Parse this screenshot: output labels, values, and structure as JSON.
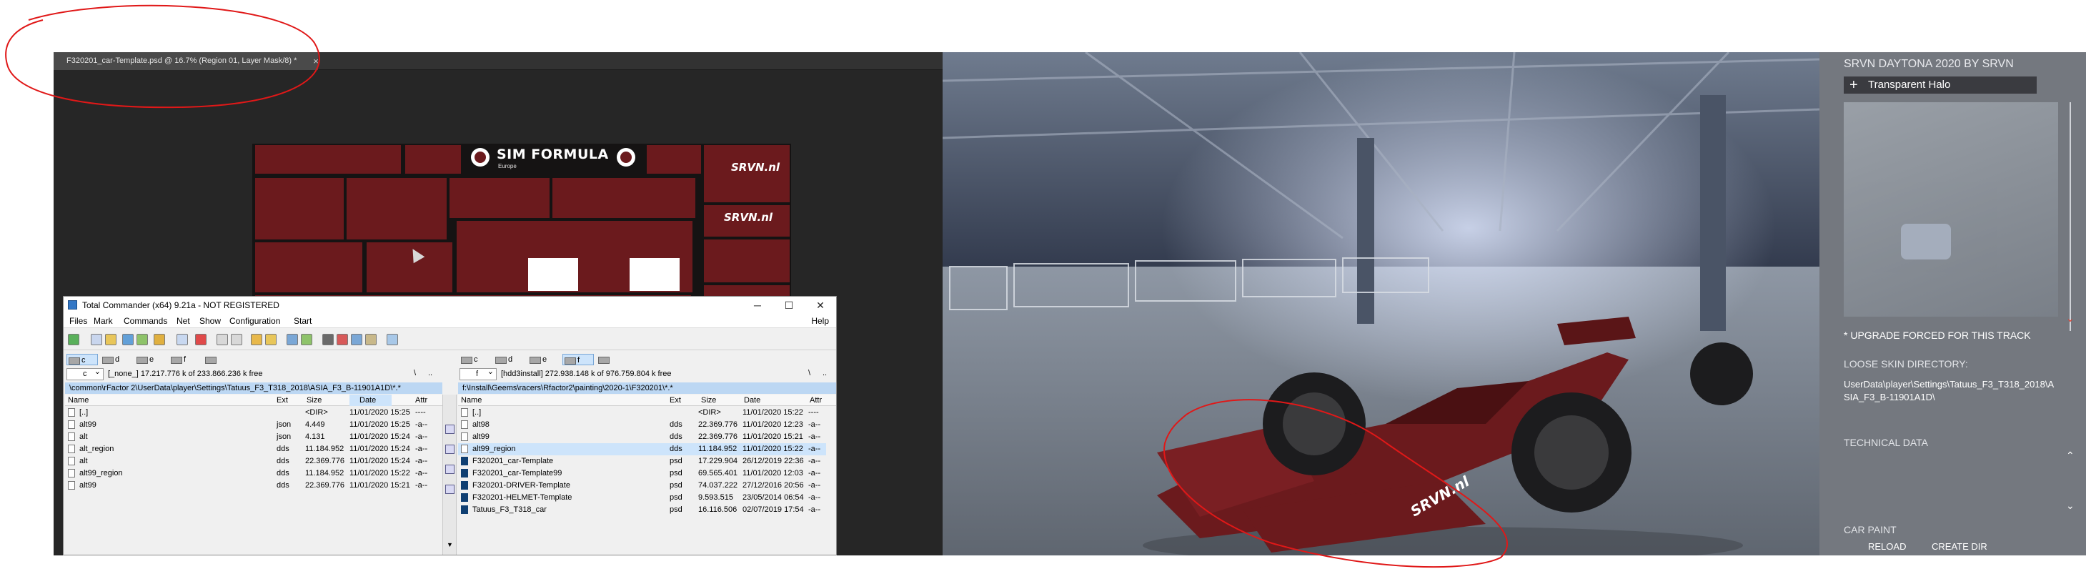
{
  "colors": {
    "livery_red": "#6b1a1d",
    "annotation_red": "#e01818",
    "tc_path_bar": "#bcd7f3",
    "tc_selection": "#cde4fb"
  },
  "photoshop": {
    "tab_title": "F320201_car-Template.psd @ 16.7% (Region 01, Layer Mask/8) *",
    "tab_close": "×",
    "template": {
      "logo_title": "SIM FORMULA",
      "logo_sub": "Europe",
      "srvn_1": "SRVN.nl",
      "srvn_2": "SRVN.nl"
    }
  },
  "total_commander": {
    "title": "Total Commander (x64) 9.21a - NOT REGISTERED",
    "window_buttons": {
      "minimize": "─",
      "maximize": "☐",
      "close": "✕"
    },
    "menu": [
      "Files",
      "Mark",
      "Commands",
      "Net",
      "Show",
      "Configuration",
      "Start"
    ],
    "help": "Help",
    "left": {
      "drives": [
        "c",
        "d",
        "e",
        "f"
      ],
      "drive_select": "c",
      "drive_info": "[_none_]  17.217.776 k of 233.866.236 k free",
      "nav_root": "\\",
      "nav_up": "..",
      "path": "\\common\\rFactor 2\\UserData\\player\\Settings\\Tatuus_F3_T318_2018\\ASIA_F3_B-11901A1D\\*.*",
      "headers": {
        "name": "Name",
        "ext": "Ext",
        "size": "Size",
        "date": "Date",
        "attr": "Attr"
      },
      "files": [
        {
          "name": "[..]",
          "ext": "",
          "size": "<DIR>",
          "date": "11/01/2020 15:25",
          "attr": "----"
        },
        {
          "name": "alt99",
          "ext": "json",
          "size": "4.449",
          "date": "11/01/2020 15:25",
          "attr": "-a--"
        },
        {
          "name": "alt",
          "ext": "json",
          "size": "4.131",
          "date": "11/01/2020 15:24",
          "attr": "-a--"
        },
        {
          "name": "alt_region",
          "ext": "dds",
          "size": "11.184.952",
          "date": "11/01/2020 15:24",
          "attr": "-a--"
        },
        {
          "name": "alt",
          "ext": "dds",
          "size": "22.369.776",
          "date": "11/01/2020 15:24",
          "attr": "-a--"
        },
        {
          "name": "alt99_region",
          "ext": "dds",
          "size": "11.184.952",
          "date": "11/01/2020 15:22",
          "attr": "-a--"
        },
        {
          "name": "alt99",
          "ext": "dds",
          "size": "22.369.776",
          "date": "11/01/2020 15:21",
          "attr": "-a--"
        }
      ]
    },
    "right": {
      "drives": [
        "c",
        "d",
        "e",
        "f"
      ],
      "drive_select": "f",
      "drive_info": "[hdd3install]  272.938.148 k of 976.759.804 k free",
      "nav_root": "\\",
      "nav_up": "..",
      "path": "f:\\Install\\Geems\\racers\\Rfactor2\\painting\\2020-1\\F320201\\*.*",
      "headers": {
        "name": "Name",
        "ext": "Ext",
        "size": "Size",
        "date": "Date",
        "attr": "Attr"
      },
      "files": [
        {
          "name": "[..]",
          "ext": "",
          "size": "<DIR>",
          "date": "11/01/2020 15:22",
          "attr": "----"
        },
        {
          "name": "alt98",
          "ext": "dds",
          "size": "22.369.776",
          "date": "11/01/2020 12:23",
          "attr": "-a--"
        },
        {
          "name": "alt99",
          "ext": "dds",
          "size": "22.369.776",
          "date": "11/01/2020 15:21",
          "attr": "-a--"
        },
        {
          "name": "alt99_region",
          "ext": "dds",
          "size": "11.184.952",
          "date": "11/01/2020 15:22",
          "attr": "-a--"
        },
        {
          "name": "F320201_car-Template",
          "ext": "psd",
          "size": "17.229.904",
          "date": "26/12/2019 22:36",
          "attr": "-a--"
        },
        {
          "name": "F320201_car-Template99",
          "ext": "psd",
          "size": "69.565.401",
          "date": "11/01/2020 12:03",
          "attr": "-a--"
        },
        {
          "name": "F320201-DRIVER-Template",
          "ext": "psd",
          "size": "74.037.222",
          "date": "27/12/2016 20:56",
          "attr": "-a--"
        },
        {
          "name": "F320201-HELMET-Template",
          "ext": "psd",
          "size": "9.593.515",
          "date": "23/05/2014 06:54",
          "attr": "-a--"
        },
        {
          "name": "Tatuus_F3_T318_car",
          "ext": "psd",
          "size": "16.116.506",
          "date": "02/07/2019 17:54",
          "attr": "-a--"
        }
      ]
    }
  },
  "rfactor": {
    "header": "SRVN DAYTONA 2020 BY SRVN",
    "option_plus": "+",
    "option_label": "Transparent Halo",
    "upgrade_note": "* UPGRADE FORCED FOR THIS TRACK",
    "skin_dir_label": "LOOSE SKIN DIRECTORY:",
    "skin_dir_value": "UserData\\player\\Settings\\Tatuus_F3_T318_2018\\ASIA_F3_B-11901A1D\\",
    "tech_label": "TECHNICAL DATA",
    "carpaint_label": "CAR PAINT",
    "reload": "RELOAD",
    "create_dir": "CREATE DIR",
    "car_livery": "SRVN.nl"
  }
}
